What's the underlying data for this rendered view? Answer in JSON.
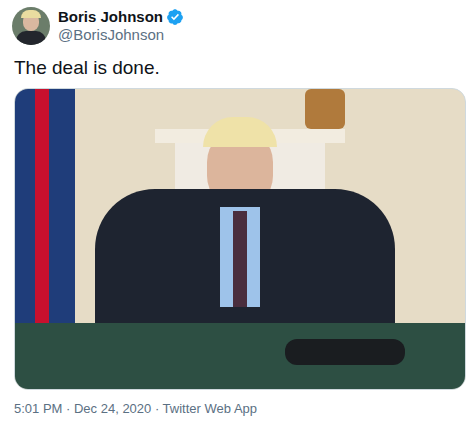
{
  "user": {
    "name": "Boris Johnson",
    "handle": "@BorisJohnson",
    "verified": true
  },
  "tweet": {
    "text": "The deal is done."
  },
  "meta": {
    "timestamp": "5:01 PM · Dec 24, 2020 · Twitter Web App"
  }
}
